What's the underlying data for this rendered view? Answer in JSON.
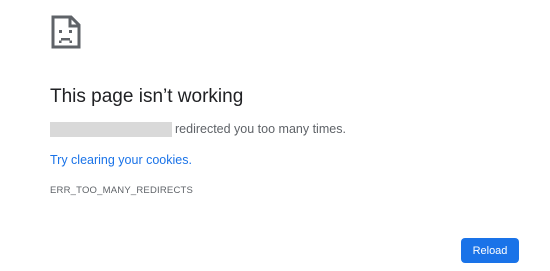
{
  "error_page": {
    "icon": "sad-page-icon",
    "title": "This page isn’t working",
    "message_suffix": "redirected you too many times.",
    "suggestion_link": "Try clearing your cookies.",
    "error_code": "ERR_TOO_MANY_REDIRECTS",
    "reload_label": "Reload"
  },
  "colors": {
    "title": "#202124",
    "body_text": "#5f6368",
    "link": "#1a73e8",
    "button_bg": "#1a73e8",
    "button_text": "#ffffff",
    "redaction": "#d9d9d9"
  }
}
